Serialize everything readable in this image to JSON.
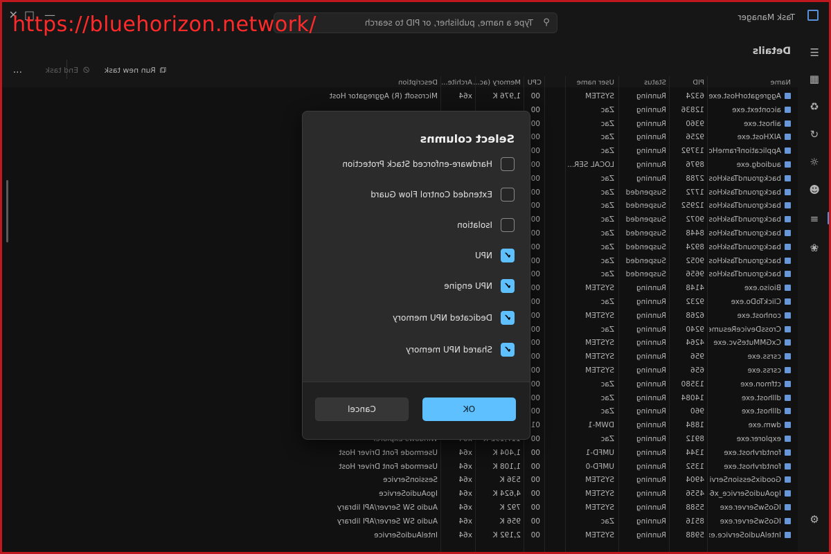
{
  "watermark": "https://bluehorizon.network/",
  "window": {
    "title": "Task Manager"
  },
  "search": {
    "placeholder": "Type a name, publisher, or PID to search"
  },
  "toolbar": {
    "page_title": "Details",
    "run_new_task": "Run new task",
    "end_task": "End task",
    "more": "..."
  },
  "table": {
    "headers": [
      "Name",
      "PID",
      "Status",
      "User name",
      "CPU",
      "Memory (ac...",
      "Archite...",
      "Description"
    ],
    "rows": [
      {
        "name": "AggregatorHost.exe",
        "pid": "6324",
        "status": "Running",
        "user": "SYSTEM",
        "cpu": "00",
        "mem": "1,976 K",
        "arch": "x64",
        "desc": "Microsoft (R) Aggregator Host"
      },
      {
        "name": "aicontext.exe",
        "pid": "12836",
        "status": "Running",
        "user": "Zac",
        "cpu": "00",
        "mem": "",
        "arch": "",
        "desc": ""
      },
      {
        "name": "aihost.exe",
        "pid": "9360",
        "status": "Running",
        "user": "Zac",
        "cpu": "00",
        "mem": "",
        "arch": "",
        "desc": ""
      },
      {
        "name": "AIXHost.exe",
        "pid": "9256",
        "status": "Running",
        "user": "Zac",
        "cpu": "00",
        "mem": "",
        "arch": "",
        "desc": ""
      },
      {
        "name": "ApplicationFrameHos...",
        "pid": "13792",
        "status": "Running",
        "user": "Zac",
        "cpu": "00",
        "mem": "",
        "arch": "",
        "desc": ""
      },
      {
        "name": "audiodg.exe",
        "pid": "8976",
        "status": "Running",
        "user": "LOCAL SER...",
        "cpu": "00",
        "mem": "",
        "arch": "",
        "desc": ""
      },
      {
        "name": "backgroundTaskHost...",
        "pid": "2788",
        "status": "Running",
        "user": "Zac",
        "cpu": "00",
        "mem": "",
        "arch": "",
        "desc": ""
      },
      {
        "name": "backgroundTaskHost...",
        "pid": "1772",
        "status": "Suspended",
        "user": "Zac",
        "cpu": "00",
        "mem": "",
        "arch": "",
        "desc": ""
      },
      {
        "name": "backgroundTaskHost...",
        "pid": "12952",
        "status": "Suspended",
        "user": "Zac",
        "cpu": "00",
        "mem": "",
        "arch": "",
        "desc": ""
      },
      {
        "name": "backgroundTaskHost...",
        "pid": "9072",
        "status": "Suspended",
        "user": "Zac",
        "cpu": "00",
        "mem": "",
        "arch": "",
        "desc": ""
      },
      {
        "name": "backgroundTaskHost...",
        "pid": "8448",
        "status": "Suspended",
        "user": "Zac",
        "cpu": "00",
        "mem": "",
        "arch": "",
        "desc": ""
      },
      {
        "name": "backgroundTaskHost...",
        "pid": "8924",
        "status": "Suspended",
        "user": "Zac",
        "cpu": "00",
        "mem": "",
        "arch": "",
        "desc": ""
      },
      {
        "name": "backgroundTaskHost...",
        "pid": "9052",
        "status": "Suspended",
        "user": "Zac",
        "cpu": "00",
        "mem": "",
        "arch": "",
        "desc": ""
      },
      {
        "name": "backgroundTaskHost...",
        "pid": "9656",
        "status": "Suspended",
        "user": "Zac",
        "cpu": "00",
        "mem": "",
        "arch": "",
        "desc": ""
      },
      {
        "name": "Bioiso.exe",
        "pid": "4148",
        "status": "Running",
        "user": "SYSTEM",
        "cpu": "00",
        "mem": "",
        "arch": "",
        "desc": ""
      },
      {
        "name": "ClickToDo.exe",
        "pid": "9232",
        "status": "Running",
        "user": "Zac",
        "cpu": "00",
        "mem": "",
        "arch": "",
        "desc": ""
      },
      {
        "name": "conhost.exe",
        "pid": "6268",
        "status": "Running",
        "user": "SYSTEM",
        "cpu": "00",
        "mem": "",
        "arch": "",
        "desc": ""
      },
      {
        "name": "CrossDeviceResume.e...",
        "pid": "9240",
        "status": "Running",
        "user": "Zac",
        "cpu": "00",
        "mem": "",
        "arch": "",
        "desc": ""
      },
      {
        "name": "CxGMMuteSvc.exe",
        "pid": "4264",
        "status": "Running",
        "user": "SYSTEM",
        "cpu": "00",
        "mem": "",
        "arch": "",
        "desc": ""
      },
      {
        "name": "csrss.exe",
        "pid": "956",
        "status": "Running",
        "user": "SYSTEM",
        "cpu": "00",
        "mem": "",
        "arch": "",
        "desc": ""
      },
      {
        "name": "csrss.exe",
        "pid": "656",
        "status": "Running",
        "user": "SYSTEM",
        "cpu": "00",
        "mem": "",
        "arch": "",
        "desc": ""
      },
      {
        "name": "ctfmon.exe",
        "pid": "13580",
        "status": "Running",
        "user": "Zac",
        "cpu": "00",
        "mem": "",
        "arch": "",
        "desc": ""
      },
      {
        "name": "dllhost.exe",
        "pid": "14084",
        "status": "Running",
        "user": "Zac",
        "cpu": "00",
        "mem": "",
        "arch": "",
        "desc": ""
      },
      {
        "name": "dllhost.exe",
        "pid": "960",
        "status": "Running",
        "user": "Zac",
        "cpu": "00",
        "mem": "",
        "arch": "",
        "desc": ""
      },
      {
        "name": "dwm.exe",
        "pid": "1884",
        "status": "Running",
        "user": "DWM-1",
        "cpu": "01",
        "mem": "",
        "arch": "",
        "desc": ""
      },
      {
        "name": "explorer.exe",
        "pid": "8912",
        "status": "Running",
        "user": "Zac",
        "cpu": "00",
        "mem": "117,192 K",
        "arch": "x64",
        "desc": "Windows Explorer"
      },
      {
        "name": "fontdrvhost.exe",
        "pid": "1344",
        "status": "Running",
        "user": "UMFD-1",
        "cpu": "00",
        "mem": "1,404 K",
        "arch": "x64",
        "desc": "Usermode Font Driver Host"
      },
      {
        "name": "fontdrvhost.exe",
        "pid": "1352",
        "status": "Running",
        "user": "UMFD-0",
        "cpu": "00",
        "mem": "1,108 K",
        "arch": "x64",
        "desc": "Usermode Font Driver Host"
      },
      {
        "name": "GoodixSessionServic...",
        "pid": "4904",
        "status": "Running",
        "user": "SYSTEM",
        "cpu": "00",
        "mem": "536 K",
        "arch": "x64",
        "desc": "SessionService"
      },
      {
        "name": "IgoAudioService_x64...",
        "pid": "4556",
        "status": "Running",
        "user": "SYSTEM",
        "cpu": "00",
        "mem": "4,624 K",
        "arch": "x64",
        "desc": "IgoAudioService"
      },
      {
        "name": "IGoSwServer.exe",
        "pid": "5588",
        "status": "Running",
        "user": "SYSTEM",
        "cpu": "00",
        "mem": "792 K",
        "arch": "x64",
        "desc": "Audio SW Server/API library"
      },
      {
        "name": "IGoSwServer.exe",
        "pid": "8516",
        "status": "Running",
        "user": "Zac",
        "cpu": "00",
        "mem": "956 K",
        "arch": "x64",
        "desc": "Audio SW Server/API library"
      },
      {
        "name": "IntelAudioService.exe",
        "pid": "5988",
        "status": "Running",
        "user": "SYSTEM",
        "cpu": "00",
        "mem": "2,192 K",
        "arch": "x64",
        "desc": "IntelAudioService"
      }
    ]
  },
  "dialog": {
    "title": "Select columns",
    "options": [
      {
        "label": "Hardware-enforced Stack Protection",
        "checked": false
      },
      {
        "label": "Extended Control Flow Guard",
        "checked": false
      },
      {
        "label": "Isolation",
        "checked": false
      },
      {
        "label": "NPU",
        "checked": true
      },
      {
        "label": "NPU engine",
        "checked": true
      },
      {
        "label": "Dedicated NPU memory",
        "checked": true
      },
      {
        "label": "Shared NPU memory",
        "checked": true
      }
    ],
    "ok": "OK",
    "cancel": "Cancel"
  },
  "icons": {
    "menu": "hamburger-icon",
    "processes": "processes-icon",
    "performance": "performance-icon",
    "history": "history-icon",
    "startup": "startup-icon",
    "users": "users-icon",
    "details": "details-icon",
    "services": "services-icon",
    "settings": "gear-icon"
  },
  "colors": {
    "accent": "#5ec0ff",
    "watermark": "#ff2a2a",
    "frame": "#c0181f"
  }
}
